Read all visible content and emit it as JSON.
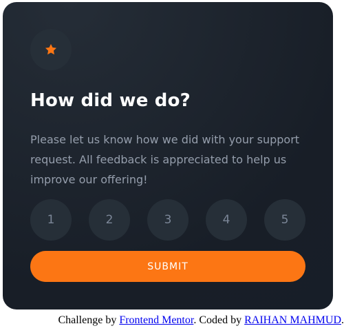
{
  "card": {
    "icon": "star-icon",
    "title": "How did we do?",
    "description": "Please let us know how we did with your support request. All feedback is appreciated to help us improve our offering!",
    "ratings": [
      "1",
      "2",
      "3",
      "4",
      "5"
    ],
    "submit_label": "SUBMIT"
  },
  "attribution": {
    "prefix": "Challenge by ",
    "frontend_link": "Frontend Mentor",
    "middle": ". Coded by ",
    "author_link": "RAIHAN MAHMUD",
    "suffix": "."
  },
  "colors": {
    "accent": "#fc7614",
    "card_bg": "#181e27",
    "circle_bg": "#262f38",
    "text_muted": "#959eac",
    "title": "#ffffff"
  }
}
